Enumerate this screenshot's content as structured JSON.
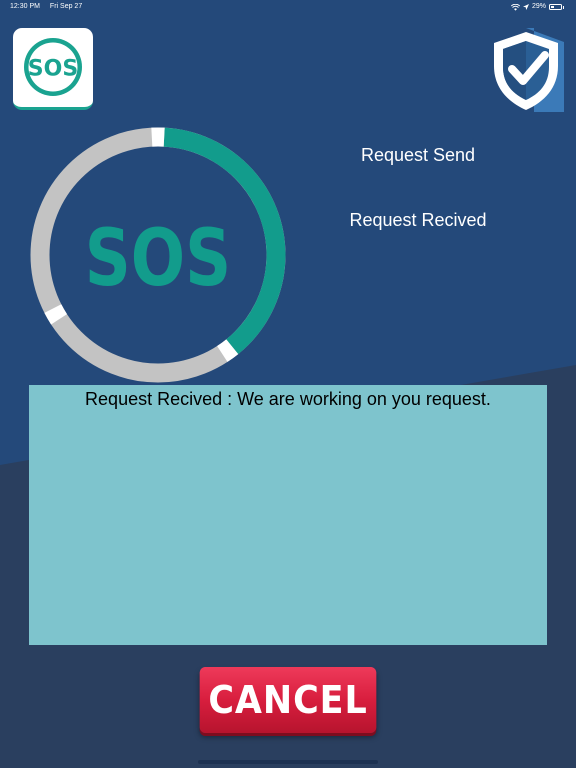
{
  "status_bar": {
    "time": "12:30 PM",
    "date": "Fri Sep 27",
    "battery": "29%",
    "battery_level": 0.29
  },
  "app_icon": {
    "text": "SOS"
  },
  "progress_ring": {
    "center_text": "SOS",
    "progress_fraction": 0.4,
    "colors": {
      "track": "#c3c3c3",
      "progress": "#129c8c",
      "marker": "#ffffff"
    }
  },
  "steps": [
    {
      "label": "Request Send"
    },
    {
      "label": "Request Recived"
    }
  ],
  "message": {
    "text": "Request Recived : We are working on you request."
  },
  "cancel_button": {
    "label": "CANCEL"
  },
  "colors": {
    "background": "#24497a",
    "background_dark": "#2a3f5f",
    "message_box": "#7ec4cd",
    "cancel": "#d81e3e",
    "accent": "#1aa390"
  }
}
